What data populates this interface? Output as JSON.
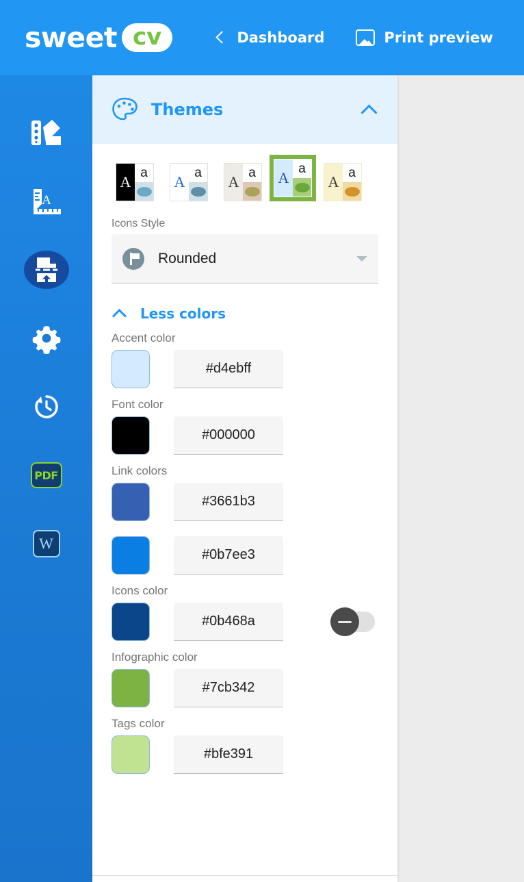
{
  "header": {
    "logo_word": "sweet",
    "logo_badge": "cv",
    "nav": [
      {
        "label": "Dashboard",
        "icon": "chevron-left-icon"
      },
      {
        "label": "Print preview",
        "icon": "image-icon"
      }
    ]
  },
  "sidebar": {
    "items": [
      {
        "name": "themes",
        "icon": "color-palette-swatches-icon",
        "active": false
      },
      {
        "name": "typography",
        "icon": "ruler-font-size-icon",
        "active": false
      },
      {
        "name": "page-break",
        "icon": "page-break-upload-icon",
        "active": true
      },
      {
        "name": "settings",
        "icon": "gear-icon",
        "active": false
      },
      {
        "name": "history",
        "icon": "clock-history-icon",
        "active": false
      },
      {
        "name": "export-pdf",
        "icon": "pdf-icon",
        "label": "PDF",
        "active": false
      },
      {
        "name": "export-word",
        "icon": "word-icon",
        "label": "W",
        "active": false
      }
    ]
  },
  "panel": {
    "title": "Themes",
    "collapse_icon": "chevron-up-icon",
    "themes": [
      {
        "id": "theme-1",
        "bg": "#000000",
        "letter_color": "#ffffff",
        "accent_bg": "#cfe0e8",
        "dot": "#6ea8c4",
        "selected": false
      },
      {
        "id": "theme-2",
        "bg": "#ffffff",
        "letter_color": "#1565c0",
        "accent_bg": "#cfe0e8",
        "dot": "#5f8fa8",
        "selected": false
      },
      {
        "id": "theme-3",
        "bg": "#eeece6",
        "letter_color": "#3e352c",
        "accent_bg": "#ddc8b4",
        "dot": "#a8a45c",
        "selected": false
      },
      {
        "id": "theme-4",
        "bg": "#d4ebff",
        "letter_color": "#2a4fb5",
        "accent_bg": "#a8d07a",
        "dot": "#6ba83a",
        "selected": true
      },
      {
        "id": "theme-5",
        "bg": "#f8f2cd",
        "letter_color": "#3e352c",
        "accent_bg": "#f2dba0",
        "dot": "#d4932a",
        "selected": false
      }
    ],
    "theme_letters": {
      "upper": "A",
      "lower": "a"
    },
    "icons_style": {
      "label": "Icons Style",
      "value": "Rounded",
      "icon": "flag-circle-icon",
      "caret": "caret-down-icon"
    },
    "less_colors": {
      "label": "Less colors",
      "icon": "chevron-up-icon"
    },
    "colors": [
      {
        "label": "Accent color",
        "value": "#d4ebff",
        "swatch": "#d4ebff",
        "toggle": null
      },
      {
        "label": "Font color",
        "value": "#000000",
        "swatch": "#000000",
        "toggle": null
      },
      {
        "label": "Link colors",
        "value": "#3661b3",
        "swatch": "#3661b3",
        "toggle": null
      },
      {
        "label": "",
        "value": "#0b7ee3",
        "swatch": "#0b7ee3",
        "toggle": null
      },
      {
        "label": "Icons color",
        "value": "#0b468a",
        "swatch": "#0b468a",
        "toggle": "off"
      },
      {
        "label": "Infographic color",
        "value": "#7cb342",
        "swatch": "#7cb342",
        "toggle": null
      },
      {
        "label": "Tags color",
        "value": "#bfe391",
        "swatch": "#bfe391",
        "toggle": null
      }
    ]
  },
  "theme_colors": {
    "brand_blue": "#2196f3",
    "sidebar_blue": "#1b7ad4",
    "header_tint": "#e3f2fd",
    "selected_green": "#7cb342",
    "logo_green": "#76c442",
    "page_bg": "#ececec"
  }
}
